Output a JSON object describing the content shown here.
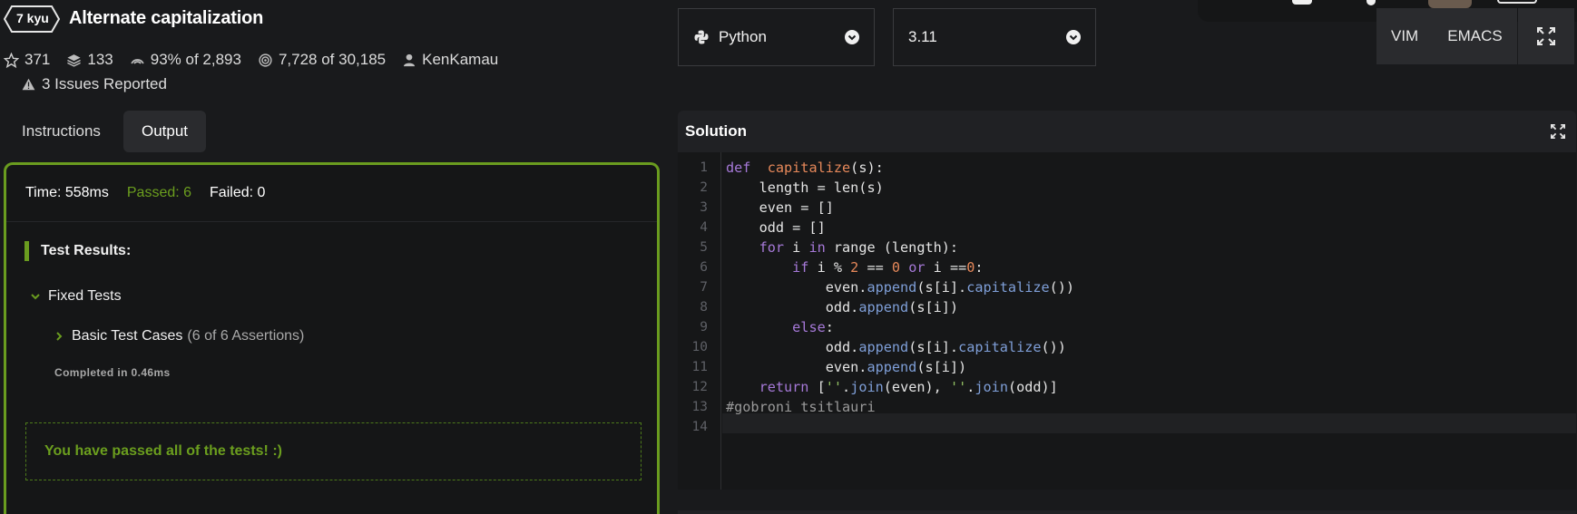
{
  "kata": {
    "rank": "7 kyu",
    "title": "Alternate capitalization"
  },
  "stats": {
    "stars": "371",
    "collections": "133",
    "satisfaction": "93% of 2,893",
    "completed": "7,728 of 30,185",
    "author": "KenKamau"
  },
  "issues": "3 Issues Reported",
  "tabs": {
    "instructions": "Instructions",
    "output": "Output"
  },
  "output": {
    "time": "Time: 558ms",
    "passed": "Passed: 6",
    "failed": "Failed: 0",
    "results_heading": "Test Results:",
    "group_label": "Fixed Tests",
    "case_label": "Basic Test Cases",
    "case_detail": "(6 of 6 Assertions)",
    "completed_in": "Completed in 0.46ms",
    "success_message": "You have passed all of the tests! :)"
  },
  "language": {
    "selected": "Python",
    "icon": "python-icon"
  },
  "version": {
    "selected": "3.11"
  },
  "modes": {
    "vim": "VIM",
    "emacs": "EMACS"
  },
  "solution": {
    "title": "Solution",
    "line_numbers": [
      "1",
      "2",
      "3",
      "4",
      "5",
      "6",
      "7",
      "8",
      "9",
      "10",
      "11",
      "12",
      "13",
      "14"
    ]
  },
  "colors": {
    "accent_green": "#6a9c1f",
    "background": "#191a1c",
    "keyword": "#a679d8",
    "function": "#e6885a",
    "method": "#7f9fd8",
    "string": "#94c264"
  }
}
